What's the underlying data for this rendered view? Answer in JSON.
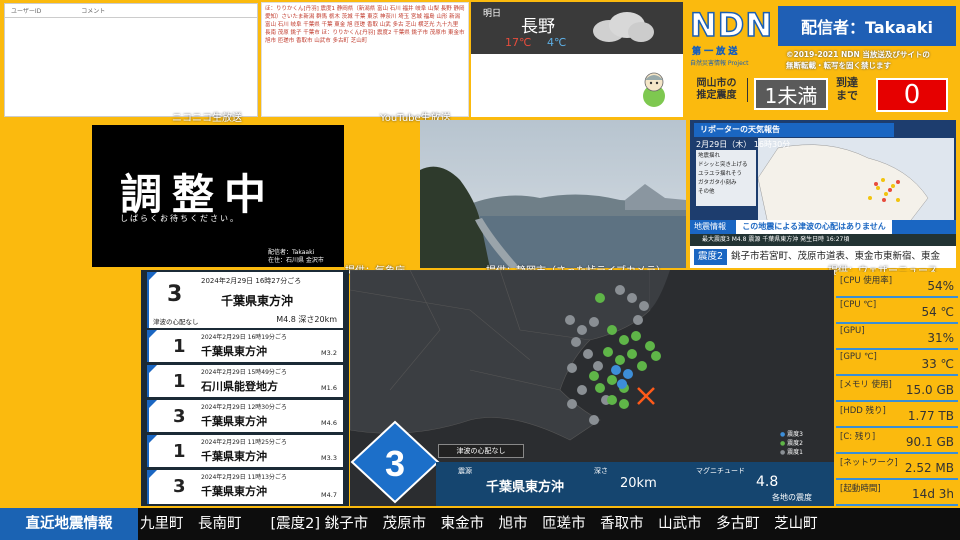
{
  "nico": {
    "col_user": "ユーザーID",
    "col_comment": "コメント",
    "label": "ニコニコ生放送"
  },
  "youtube": {
    "label": "YouTube生放送",
    "text": "ほ：りりかくん[丹羽] 震度1 静岡県（新潟県 富山 石川 福井 岐阜 山梨 長野 静岡 愛知）さいたま新潟 群馬 栃木 茨城 千葉 東京 神奈川 埼玉 宮城 福島 山形 新潟 富山 石川 岐阜 千葉県 千葉 東金 旭 匝瑳 香取 山武 多古 芝山 横芝光 九十九里 長南 茂原 銚子 千葉市 ほ：りりかくん[丹羽] 震度2 千葉県 銚子市 茂原市 東金市 旭市 匝瑳市 香取市 山武市 多古町 芝山町"
  },
  "weather": {
    "tomorrow": "明日",
    "city": "長野",
    "high": "17℃",
    "low": "4℃"
  },
  "ndn": {
    "logo": "NDN",
    "host": "配信者：Takaaki",
    "sub": "第 一 放 送",
    "sub2": "自然災害情報 Project",
    "copyright_1": "©2019-2021 NDN 当放送及びサイトの",
    "copyright_2": "無断転載・転写を固く禁じます",
    "okl_1": "岡山市の",
    "okl_2": "推定震度",
    "intensity": "1未満",
    "arrival_1": "到達",
    "arrival_2": "まで",
    "countdown": "0"
  },
  "maint": {
    "title": "調整中",
    "sub": "しばらくお待ちください。",
    "credit_1": "配信者：Takaaki",
    "credit_2": "在住：石川県 金沢市"
  },
  "reporter": {
    "head": "リポーターの天気報告",
    "date": "2月29日（木） 16時30分",
    "legend_title": "地震揺れ",
    "legend": [
      "ドシッと突き上げる",
      "ユラユラ揺れそう",
      "ガタガタ小刻み",
      "その他"
    ],
    "bar1_label": "地震情報",
    "bar1_msg": "この地震による津波の心配はありません",
    "bar2": "最大震度3  M4.8  震源 千葉県東方沖  発生日時 16:27頃",
    "bar3_badge": "震度2",
    "bar3": "銚子市若宮町、茂原市道表、東金市東新宿、東金"
  },
  "credits": {
    "jma": "提供：気象庁",
    "shizuoka": "提供：静岡市（さった峠ライブカメラ）",
    "weathernews": "提供：ウェザーニュース"
  },
  "history": [
    {
      "intensity": "3",
      "datetime": "2024年2月29日 16時27分ごろ",
      "place": "千葉県東方沖",
      "note": "津波の心配なし",
      "mag": "M4.8 深さ20km"
    },
    {
      "intensity": "1",
      "datetime": "2024年2月29日 16時19分ごろ",
      "place": "千葉県東方沖",
      "mag": "M3.2"
    },
    {
      "intensity": "1",
      "datetime": "2024年2月29日 15時49分ごろ",
      "place": "石川県能登地方",
      "mag": "M1.6"
    },
    {
      "intensity": "3",
      "datetime": "2024年2月29日 12時30分ごろ",
      "place": "千葉県東方沖",
      "mag": "M4.6"
    },
    {
      "intensity": "1",
      "datetime": "2024年2月29日 11時25分ごろ",
      "place": "千葉県東方沖",
      "mag": "M3.3"
    },
    {
      "intensity": "3",
      "datetime": "2024年2月29日 11時13分ごろ",
      "place": "千葉県東方沖",
      "mag": "M4.7"
    }
  ],
  "map": {
    "max_intensity": "3",
    "tsunami": "津波の心配なし",
    "lbl_epicenter": "震源",
    "epicenter": "千葉県東方沖",
    "lbl_depth": "深さ",
    "depth": "20km",
    "lbl_mag": "マグニチュード",
    "mag": "4.8",
    "area_label": "各地の震度",
    "legend": [
      "震度3",
      "震度2",
      "震度1"
    ]
  },
  "stats": [
    {
      "label": "[CPU 使用率]",
      "value": "54%"
    },
    {
      "label": "[CPU ℃]",
      "value": "54 ℃"
    },
    {
      "label": "[GPU]",
      "value": "31%"
    },
    {
      "label": "[GPU ℃]",
      "value": "33 ℃"
    },
    {
      "label": "[メモリ 使用]",
      "value": "15.0 GB"
    },
    {
      "label": "[HDD 残り]",
      "value": "1.77 TB"
    },
    {
      "label": "[C: 残り]",
      "value": "90.1 GB"
    },
    {
      "label": "[ネットワーク]",
      "value": "2.52 MB"
    },
    {
      "label": "[起動時間]",
      "value": "14d 3h"
    }
  ],
  "ticker": {
    "label": "直近地震情報",
    "text": "九里町　長南町　　[震度2] 銚子市　茂原市　東金市　旭市　匝瑳市　香取市　山武市　多古町　芝山町"
  }
}
